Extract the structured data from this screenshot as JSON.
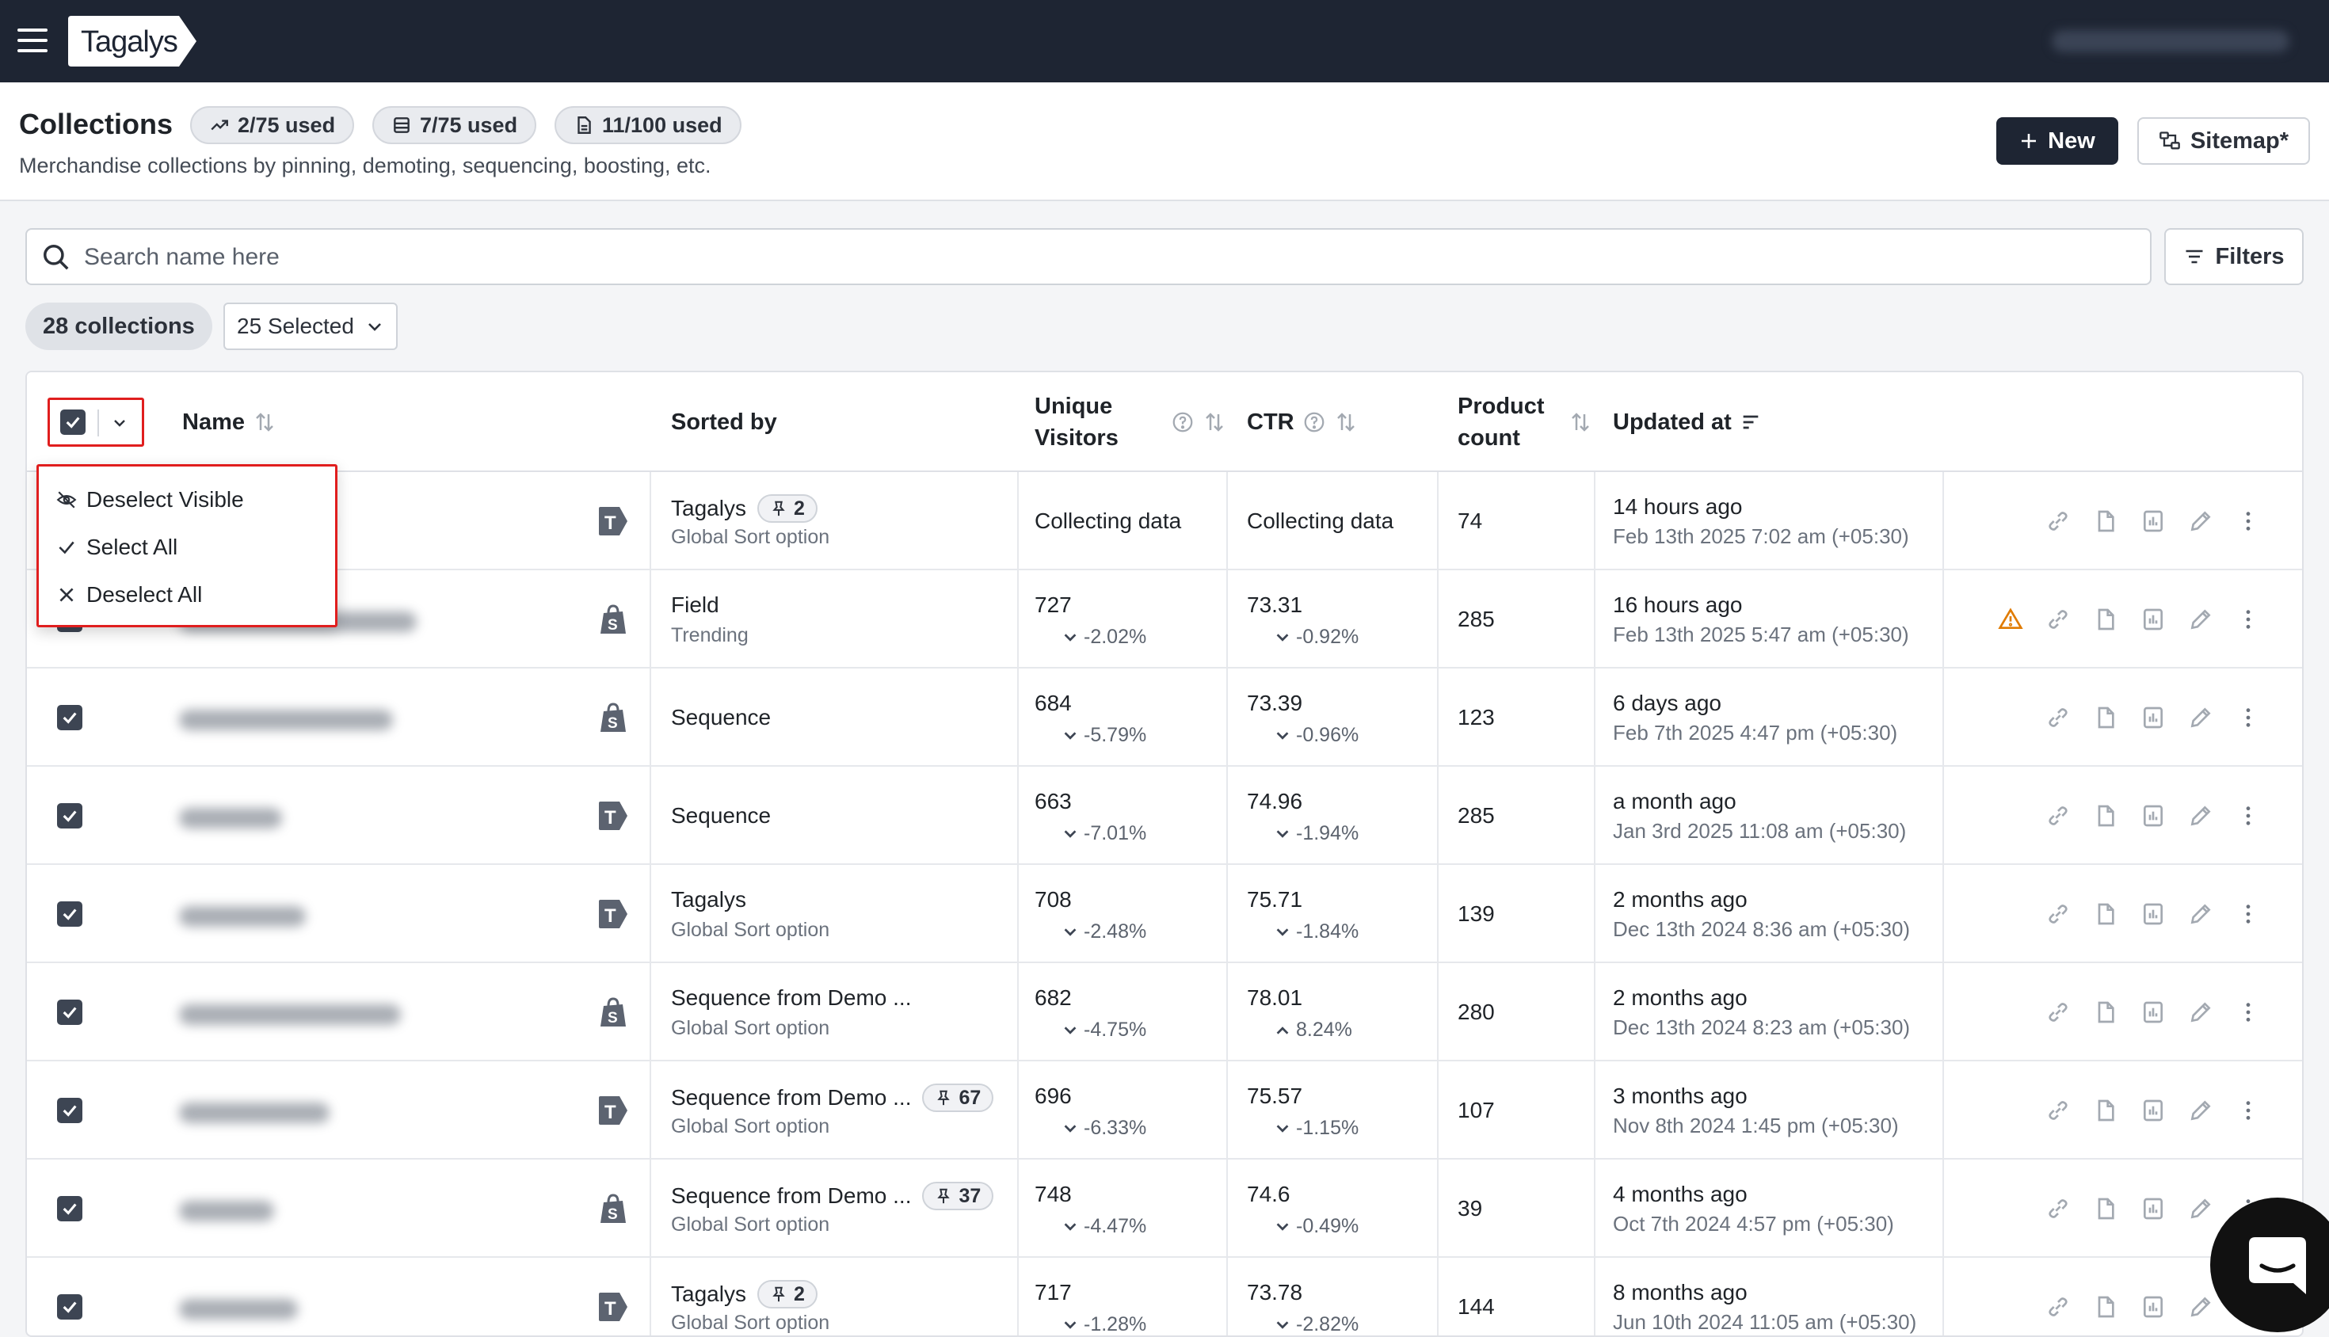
{
  "app": {
    "logo_text": "Tagalys"
  },
  "header": {
    "title": "Collections",
    "usage": [
      {
        "icon": "trending-up-icon",
        "label": "2/75 used"
      },
      {
        "icon": "list-icon",
        "label": "7/75 used"
      },
      {
        "icon": "document-icon",
        "label": "11/100 used"
      }
    ],
    "subtitle": "Merchandise collections by pinning, demoting, sequencing, boosting, etc.",
    "new_label": "New",
    "sitemap_label": "Sitemap*"
  },
  "search": {
    "placeholder": "Search name here"
  },
  "filters_label": "Filters",
  "collections_count": "28 collections",
  "selected_label": "25 Selected",
  "table": {
    "headers": {
      "name": "Name",
      "sorted_by": "Sorted by",
      "unique_visitors_l1": "Unique",
      "unique_visitors_l2": "Visitors",
      "ctr": "CTR",
      "product_count_l1": "Product",
      "product_count_l2": "count",
      "updated_at": "Updated at"
    },
    "rows": [
      {
        "source": "tagalys",
        "sorted_main": "Tagalys",
        "pins": "2",
        "sorted_sub": "Global Sort option",
        "visitors": "Collecting data",
        "visitors_delta": "",
        "ctr": "Collecting data",
        "ctr_delta": "",
        "ctr_dir": "down",
        "product_count": "74",
        "updated_rel": "14 hours ago",
        "updated_abs": "Feb 13th 2025 7:02 am (+05:30)",
        "warning": false
      },
      {
        "source": "shopify",
        "sorted_main": "Field",
        "pins": "",
        "sorted_sub": "Trending",
        "visitors": "727",
        "visitors_delta": "-2.02%",
        "ctr": "73.31",
        "ctr_delta": "-0.92%",
        "ctr_dir": "down",
        "product_count": "285",
        "updated_rel": "16 hours ago",
        "updated_abs": "Feb 13th 2025 5:47 am (+05:30)",
        "warning": true
      },
      {
        "source": "shopify",
        "sorted_main": "Sequence",
        "pins": "",
        "sorted_sub": "",
        "visitors": "684",
        "visitors_delta": "-5.79%",
        "ctr": "73.39",
        "ctr_delta": "-0.96%",
        "ctr_dir": "down",
        "product_count": "123",
        "updated_rel": "6 days ago",
        "updated_abs": "Feb 7th 2025 4:47 pm (+05:30)",
        "warning": false
      },
      {
        "source": "tagalys",
        "sorted_main": "Sequence",
        "pins": "",
        "sorted_sub": "",
        "visitors": "663",
        "visitors_delta": "-7.01%",
        "ctr": "74.96",
        "ctr_delta": "-1.94%",
        "ctr_dir": "down",
        "product_count": "285",
        "updated_rel": "a month ago",
        "updated_abs": "Jan 3rd 2025 11:08 am (+05:30)",
        "warning": false
      },
      {
        "source": "tagalys",
        "sorted_main": "Tagalys",
        "pins": "",
        "sorted_sub": "Global Sort option",
        "visitors": "708",
        "visitors_delta": "-2.48%",
        "ctr": "75.71",
        "ctr_delta": "-1.84%",
        "ctr_dir": "down",
        "product_count": "139",
        "updated_rel": "2 months ago",
        "updated_abs": "Dec 13th 2024 8:36 am (+05:30)",
        "warning": false
      },
      {
        "source": "shopify",
        "sorted_main": "Sequence from Demo ...",
        "pins": "",
        "sorted_sub": "Global Sort option",
        "visitors": "682",
        "visitors_delta": "-4.75%",
        "ctr": "78.01",
        "ctr_delta": "8.24%",
        "ctr_dir": "up",
        "product_count": "280",
        "updated_rel": "2 months ago",
        "updated_abs": "Dec 13th 2024 8:23 am (+05:30)",
        "warning": false
      },
      {
        "source": "tagalys",
        "sorted_main": "Sequence from Demo ...",
        "pins": "67",
        "sorted_sub": "Global Sort option",
        "visitors": "696",
        "visitors_delta": "-6.33%",
        "ctr": "75.57",
        "ctr_delta": "-1.15%",
        "ctr_dir": "down",
        "product_count": "107",
        "updated_rel": "3 months ago",
        "updated_abs": "Nov 8th 2024 1:45 pm (+05:30)",
        "warning": false
      },
      {
        "source": "shopify",
        "sorted_main": "Sequence from Demo ...",
        "pins": "37",
        "sorted_sub": "Global Sort option",
        "visitors": "748",
        "visitors_delta": "-4.47%",
        "ctr": "74.6",
        "ctr_delta": "-0.49%",
        "ctr_dir": "down",
        "product_count": "39",
        "updated_rel": "4 months ago",
        "updated_abs": "Oct 7th 2024 4:57 pm (+05:30)",
        "warning": false
      },
      {
        "source": "tagalys",
        "sorted_main": "Tagalys",
        "pins": "2",
        "sorted_sub": "Global Sort option",
        "visitors": "717",
        "visitors_delta": "-1.28%",
        "ctr": "73.78",
        "ctr_delta": "-2.82%",
        "ctr_dir": "down",
        "product_count": "144",
        "updated_rel": "8 months ago",
        "updated_abs": "Jun 10th 2024 11:05 am (+05:30)",
        "warning": false
      }
    ]
  },
  "select_menu": {
    "items": [
      {
        "icon": "eye-off-icon",
        "label": "Deselect Visible"
      },
      {
        "icon": "check-icon",
        "label": "Select All"
      },
      {
        "icon": "close-icon",
        "label": "Deselect All"
      }
    ]
  },
  "colors": {
    "topbar": "#1e2533",
    "accent_dark": "#1e2533",
    "highlight": "#e01e1e",
    "warning": "#e07b00"
  }
}
